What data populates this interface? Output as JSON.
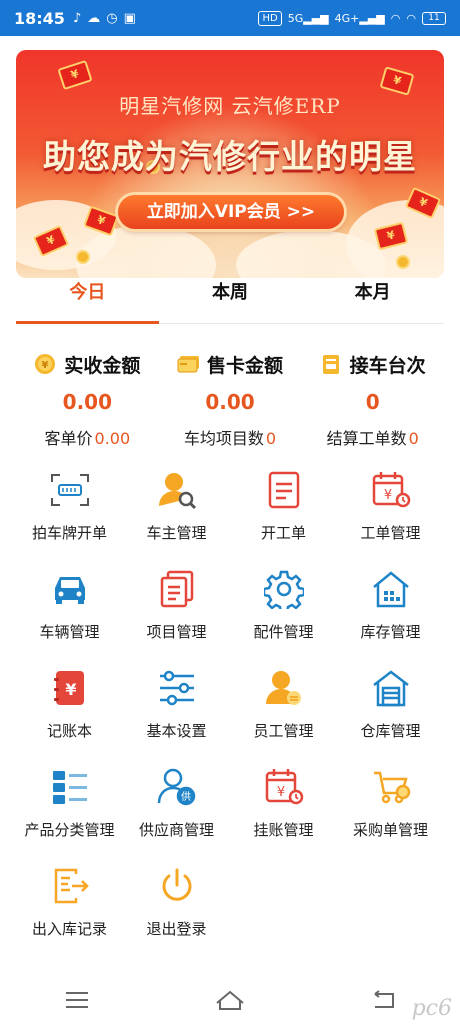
{
  "status": {
    "time": "18:45",
    "left_icons": [
      "tiktok-icon",
      "cloud-icon",
      "clock-icon",
      "sim-icon"
    ],
    "right_icons": [
      "hd-icon",
      "5g-signal-icon",
      "4g-signal-icon",
      "wifi-icon",
      "wifi-icon"
    ],
    "chip_hd": "HD",
    "chip_5g": "5G",
    "chip_4g": "4G+",
    "battery": "11"
  },
  "banner": {
    "subtitle": "明星汽修网 云汽修ERP",
    "title": "助您成为汽修行业的明星",
    "button": "立即加入VIP会员 >>",
    "envelope_mark": "¥"
  },
  "tabs": [
    {
      "label": "今日",
      "active": true
    },
    {
      "label": "本周",
      "active": false
    },
    {
      "label": "本月",
      "active": false
    }
  ],
  "stats": [
    {
      "label": "实收金额",
      "value": "0.00",
      "icon": "coin-icon"
    },
    {
      "label": "售卡金额",
      "value": "0.00",
      "icon": "card-icon"
    },
    {
      "label": "接车台次",
      "value": "0",
      "icon": "clipboard-car-icon"
    }
  ],
  "sub_stats": [
    {
      "label": "客单价",
      "value": "0.00"
    },
    {
      "label": "车均项目数",
      "value": "0"
    },
    {
      "label": "结算工单数",
      "value": "0"
    }
  ],
  "menu": [
    {
      "label": "拍车牌开单",
      "icon": "plate-scan-icon"
    },
    {
      "label": "车主管理",
      "icon": "user-search-icon"
    },
    {
      "label": "开工单",
      "icon": "document-icon"
    },
    {
      "label": "工单管理",
      "icon": "calendar-yuan-icon"
    },
    {
      "label": "车辆管理",
      "icon": "car-icon"
    },
    {
      "label": "项目管理",
      "icon": "copy-document-icon"
    },
    {
      "label": "配件管理",
      "icon": "gear-icon"
    },
    {
      "label": "库存管理",
      "icon": "warehouse-icon"
    },
    {
      "label": "记账本",
      "icon": "ledger-icon"
    },
    {
      "label": "基本设置",
      "icon": "sliders-icon"
    },
    {
      "label": "员工管理",
      "icon": "employee-icon"
    },
    {
      "label": "仓库管理",
      "icon": "storehouse-icon"
    },
    {
      "label": "产品分类管理",
      "icon": "category-list-icon"
    },
    {
      "label": "供应商管理",
      "icon": "supplier-icon"
    },
    {
      "label": "挂账管理",
      "icon": "credit-calendar-icon"
    },
    {
      "label": "采购单管理",
      "icon": "purchase-cart-icon"
    },
    {
      "label": "出入库记录",
      "icon": "in-out-record-icon"
    },
    {
      "label": "退出登录",
      "icon": "power-icon"
    }
  ],
  "watermark": "pc6",
  "colors": {
    "status_bar": "#1976d2",
    "accent": "#e8561f",
    "icon_red": "#e5463a",
    "icon_blue": "#1f84c7",
    "icon_orange": "#f5a623"
  }
}
